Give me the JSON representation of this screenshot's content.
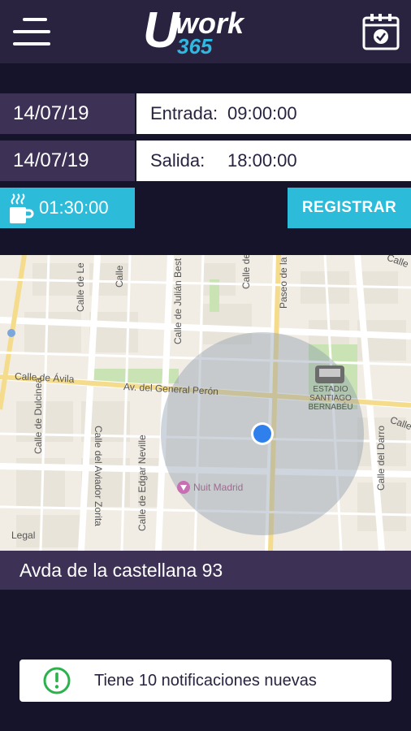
{
  "header": {
    "logo_main": "work",
    "logo_letter": "U",
    "logo_sub": "365",
    "menu_icon": "hamburger-menu-icon",
    "calendar_icon": "calendar-check-icon"
  },
  "entry": {
    "date": "14/07/19",
    "label": "Entrada:",
    "time": "09:00:00"
  },
  "exit": {
    "date": "14/07/19",
    "label": "Salida:",
    "time": "18:00:00"
  },
  "break": {
    "icon": "coffee-cup-icon",
    "time": "01:30:00"
  },
  "register_button": {
    "label": "REGISTRAR"
  },
  "map": {
    "streets": {
      "avila": "Calle de Ávila",
      "general_peron": "Av. del General Perón",
      "dulcinea": "Calle de Dulcinea",
      "aviador_zorita": "Calle del Aviador Zorita",
      "edgar_neville": "Calle de Edgar Neville",
      "julian_besteiro": "Calle de Julián Best",
      "paseo": "Paseo de la",
      "darro": "Calle del Darro",
      "calle_lef": "Calle de Le",
      "calle_top": "Calle",
      "calle_de": "Calle de",
      "calle_right": "Calle",
      "calle_right2": "Calle"
    },
    "poi_stadium": [
      "ESTADIO",
      "SANTIAGO",
      "BERNABÉU"
    ],
    "poi_nuit": "Nuit Madrid",
    "legal": "Legal",
    "accent": "#2f80ed"
  },
  "address": {
    "text": "Avda de la castellana 93"
  },
  "notification": {
    "icon": "alert-circle-icon",
    "text": "Tiene 10 notificaciones nuevas",
    "icon_color": "#2bb24c"
  }
}
